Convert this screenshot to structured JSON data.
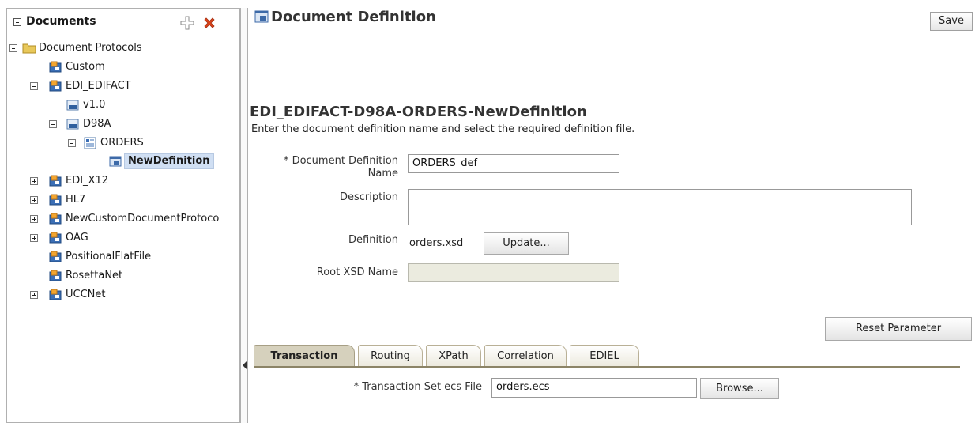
{
  "left_panel": {
    "title": "Documents",
    "tree": {
      "root": "Document Protocols",
      "items": {
        "custom": "Custom",
        "edi_edifact": "EDI_EDIFACT",
        "v1": "v1.0",
        "d98a": "D98A",
        "orders": "ORDERS",
        "new_definition": "NewDefinition",
        "edi_x12": "EDI_X12",
        "hl7": "HL7",
        "new_custom": "NewCustomDocumentProtoco",
        "oag": "OAG",
        "positional": "PositionalFlatFile",
        "rosettanet": "RosettaNet",
        "uccnet": "UCCNet"
      }
    }
  },
  "main": {
    "title": "Document Definition",
    "save_label": "Save",
    "definition_heading": "EDI_EDIFACT-D98A-ORDERS-NewDefinition",
    "subtitle": "Enter the document definition name and select the required definition file.",
    "form": {
      "name_label_line1": "Document Definition",
      "name_label_line2": "Name",
      "name_value": "ORDERS_def",
      "description_label": "Description",
      "description_value": "",
      "definition_label": "Definition",
      "definition_value": "orders.xsd",
      "update_label": "Update...",
      "root_xsd_label": "Root XSD Name",
      "root_xsd_value": ""
    },
    "reset_label": "Reset Parameter",
    "tabs": [
      "Transaction",
      "Routing",
      "XPath",
      "Correlation",
      "EDIEL"
    ],
    "transaction": {
      "ecs_label": "Transaction Set ecs File",
      "ecs_value": "orders.ecs",
      "browse_label": "Browse..."
    }
  },
  "colors": {
    "selection": "#d0dff3",
    "active_tab": "#d6d1bd",
    "delete_icon": "#d9421a",
    "folder": "#e8c85a"
  },
  "icons": {
    "add": "add-icon",
    "delete": "delete-icon",
    "folder": "folder-icon",
    "protocol": "protocol-icon",
    "version": "version-icon",
    "document_type": "document-type-icon",
    "definition": "document-definition-icon"
  }
}
